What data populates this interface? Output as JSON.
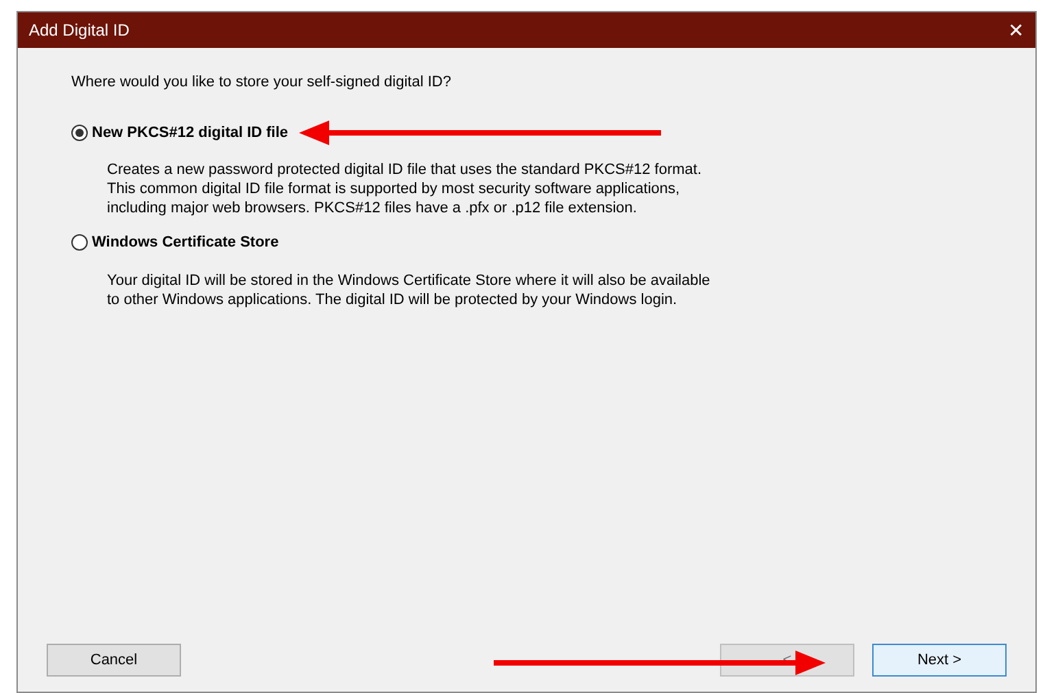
{
  "window": {
    "title": "Add Digital ID",
    "close": "✕"
  },
  "question": "Where would you like to store your self-signed digital ID?",
  "options": [
    {
      "label": "New PKCS#12 digital ID file",
      "selected": true,
      "description": [
        "Creates a new password protected digital ID file that uses the standard PKCS#12 format.",
        "This common digital ID file format is supported by most security software applications,",
        "including major web browsers. PKCS#12 files have a .pfx or .p12 file extension."
      ]
    },
    {
      "label": "Windows Certificate Store",
      "selected": false,
      "description": [
        "Your digital ID will be stored in the Windows Certificate Store where it will also be available",
        "to other Windows applications. The digital ID will be protected by your Windows login."
      ]
    }
  ],
  "buttons": [
    {
      "label": "Cancel",
      "kind": "cancel",
      "disabled": false
    },
    {
      "label": "<",
      "kind": "back",
      "disabled": true
    },
    {
      "label": "Next >",
      "kind": "next",
      "disabled": false
    }
  ]
}
